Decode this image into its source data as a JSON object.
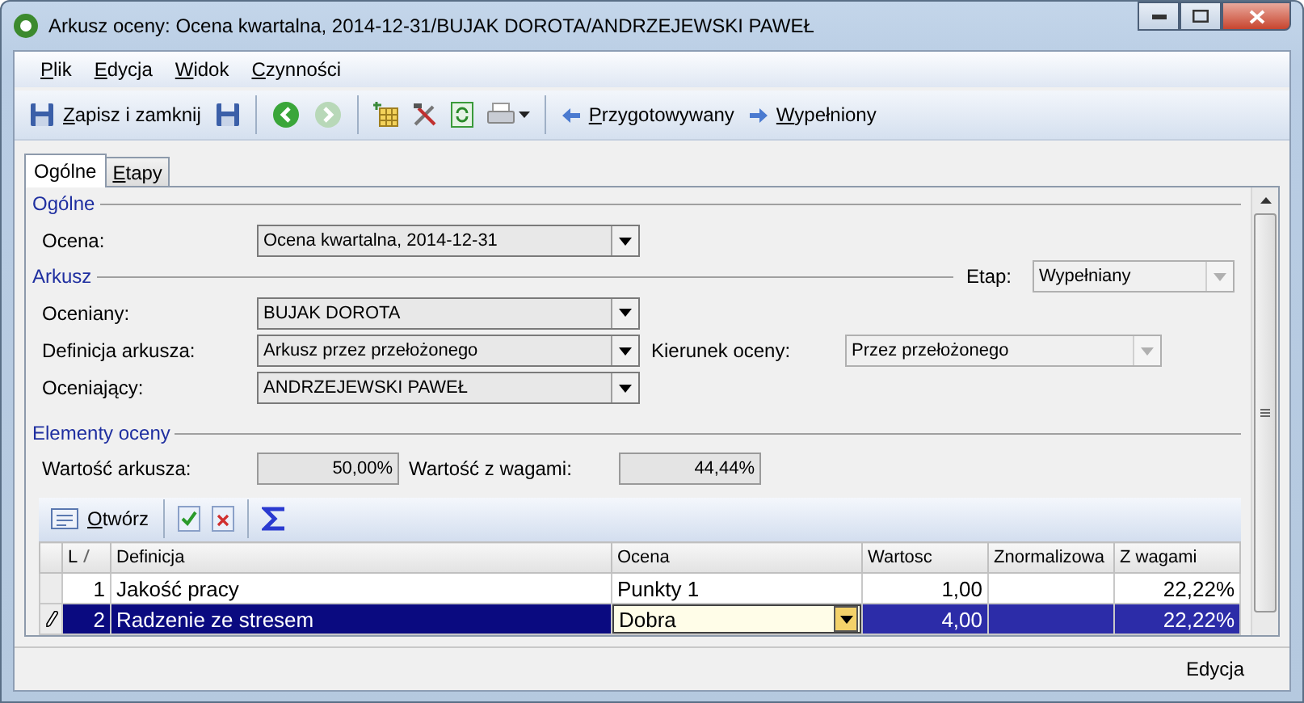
{
  "window": {
    "title": "Arkusz oceny: Ocena kwartalna, 2014-12-31/BUJAK DOROTA/ANDRZEJEWSKI PAWEŁ"
  },
  "menu": [
    "Plik",
    "Edycja",
    "Widok",
    "Czynności"
  ],
  "toolbar": {
    "save_button": "Zapisz i zamknij",
    "forward_disabled": true,
    "prev_stage": "Przygotowywany",
    "next_stage": "Wypełniony"
  },
  "tabs": [
    {
      "label": "Ogólne",
      "selected": true
    },
    {
      "label": "Etapy",
      "selected": false
    }
  ],
  "sections": {
    "general": "Ogólne",
    "sheet": "Arkusz",
    "elements": "Elementy oceny"
  },
  "ocena": {
    "label": "Ocena:",
    "value": "Ocena kwartalna, 2014-12-31",
    "disabled": false
  },
  "etap": {
    "label": "Etap:",
    "value": "Wypełniany",
    "disabled": true
  },
  "fields": [
    {
      "label": "Oceniany:",
      "value": "BUJAK DOROTA",
      "disabled": false
    },
    {
      "label": "Definicja arkusza:",
      "value": "Arkusz przez przełożonego",
      "disabled": false
    },
    {
      "label": "Oceniający:",
      "value": "ANDRZEJEWSKI PAWEŁ",
      "disabled": false
    }
  ],
  "kierunek": {
    "label": "Kierunek oceny:",
    "value": "Przez przełożonego",
    "disabled": true
  },
  "values": [
    {
      "label": "Wartość arkusza:",
      "value": "50,00%"
    },
    {
      "label": "Wartość z wagami:",
      "value": "44,44%"
    }
  ],
  "grid_toolbar": {
    "open_button": "Otwórz"
  },
  "table": {
    "columns": [
      "L",
      "Definicja",
      "Ocena",
      "Wartosc",
      "Znormalizowa",
      "Z wagami"
    ],
    "rows": [
      {
        "lp": "1",
        "definicja": "Jakość pracy",
        "ocena": "Punkty 1",
        "wartosc": "1,00",
        "znormalizowana": "",
        "z_wagami": "22,22%",
        "selected": false,
        "editing": false
      },
      {
        "lp": "2",
        "definicja": "Radzenie ze stresem",
        "ocena": "Dobra",
        "wartosc": "4,00",
        "znormalizowana": "",
        "z_wagami": "22,22%",
        "selected": true,
        "editing": true
      }
    ]
  },
  "status_bar": "Edycja"
}
